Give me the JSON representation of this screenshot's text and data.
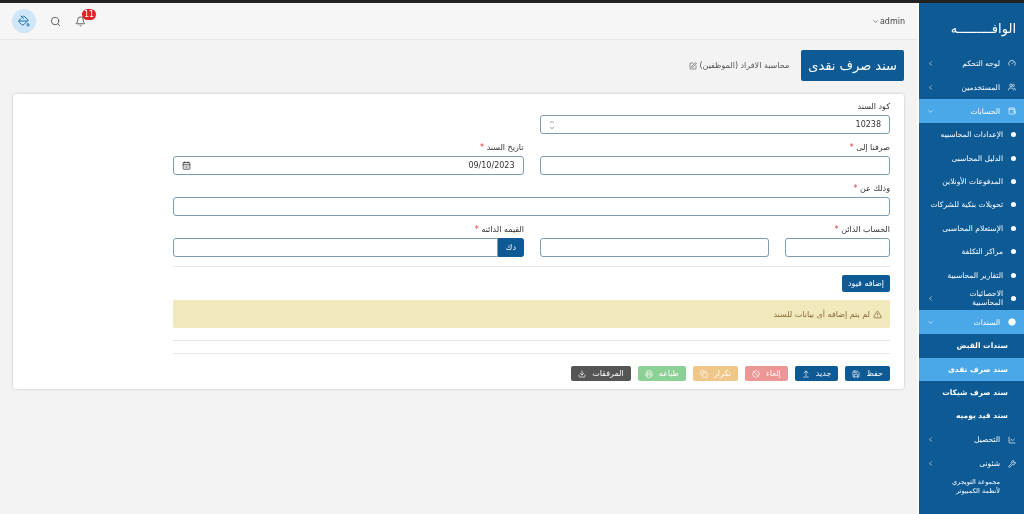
{
  "topbar": {
    "user": "admin",
    "notification_count": "11"
  },
  "sidebar": {
    "logo": "الوافـــــــــه",
    "items": [
      {
        "label": "لوحه التحكم",
        "has_arrow": true,
        "expanded": false,
        "selected": false
      },
      {
        "label": "المستخدمين",
        "has_arrow": true,
        "expanded": false,
        "selected": false
      },
      {
        "label": "الحسابات",
        "has_arrow": true,
        "expanded": true,
        "selected": true,
        "kind": "tree",
        "children": [
          {
            "label": "الإعدادات المحاسبيه",
            "has_arrow": false,
            "selected": false
          },
          {
            "label": "الدليل المحاسبى",
            "has_arrow": false,
            "selected": false
          },
          {
            "label": "المدفوعات الأونلاين",
            "has_arrow": false,
            "selected": false
          },
          {
            "label": "تحويلات بنكية للشركات",
            "has_arrow": false,
            "selected": false
          },
          {
            "label": "الإستعلام المحاسبى",
            "has_arrow": false,
            "selected": false
          },
          {
            "label": "مراكز التكلفة",
            "has_arrow": false,
            "selected": false
          },
          {
            "label": "التقارير المحاسبية",
            "has_arrow": false,
            "selected": false
          },
          {
            "label": "الاحصائيات المحاسبية",
            "has_arrow": true,
            "selected": false
          }
        ]
      },
      {
        "label": "السندات",
        "has_arrow": true,
        "expanded": true,
        "selected": true,
        "kind": "plain",
        "children": [
          {
            "label": "سندات القبض",
            "has_arrow": false,
            "selected": false
          },
          {
            "label": "سند صرف نقدى",
            "has_arrow": false,
            "selected": true
          },
          {
            "label": "سند صرف شيكات",
            "has_arrow": false,
            "selected": false
          },
          {
            "label": "سند قيد يوميه",
            "has_arrow": false,
            "selected": false
          }
        ]
      },
      {
        "label": "التحصيل",
        "has_arrow": true,
        "expanded": false,
        "selected": false
      },
      {
        "label": "شئونى",
        "has_arrow": true,
        "expanded": false,
        "selected": false
      }
    ],
    "footer": [
      "مجموعة التويجري",
      "لأنظمة الكمبيوتر"
    ]
  },
  "page": {
    "title": "سند صرف نقدى",
    "breadcrumb": "محاسبة الافراد (الموظفين)"
  },
  "form": {
    "rows": [
      [
        {
          "kind": "number",
          "label": "كود السند",
          "value": "10238"
        }
      ],
      [
        {
          "kind": "text",
          "label": "صرفنا إلى",
          "required_mark": "*"
        },
        {
          "kind": "date",
          "label": "تاريخ السند",
          "required_mark": "*",
          "value": "09/10/2023"
        }
      ],
      [
        {
          "kind": "textarea",
          "label": "وذلك عن",
          "required_mark": "*"
        }
      ],
      [
        {
          "kind": "text",
          "label": "الحساب الدائن",
          "required_mark": "*"
        },
        {
          "kind": "text"
        },
        {
          "kind": "currency",
          "label": "القيمه الدائنه",
          "required_mark": "*",
          "prefix": "دك"
        }
      ]
    ],
    "add_button": "إضافه قيود",
    "alert": "لم يتم إضافه أى بيانات للسند",
    "actions": [
      {
        "label": "حفظ",
        "kind": "save",
        "disabled": false
      },
      {
        "label": "جديد",
        "kind": "new",
        "disabled": false
      },
      {
        "label": "إلغاء",
        "kind": "cancel",
        "disabled": true
      },
      {
        "label": "تكرار",
        "kind": "copy",
        "disabled": true
      },
      {
        "label": "طباعه",
        "kind": "print",
        "disabled": true
      },
      {
        "label": "المرفقات",
        "kind": "attach",
        "disabled": false
      }
    ]
  }
}
